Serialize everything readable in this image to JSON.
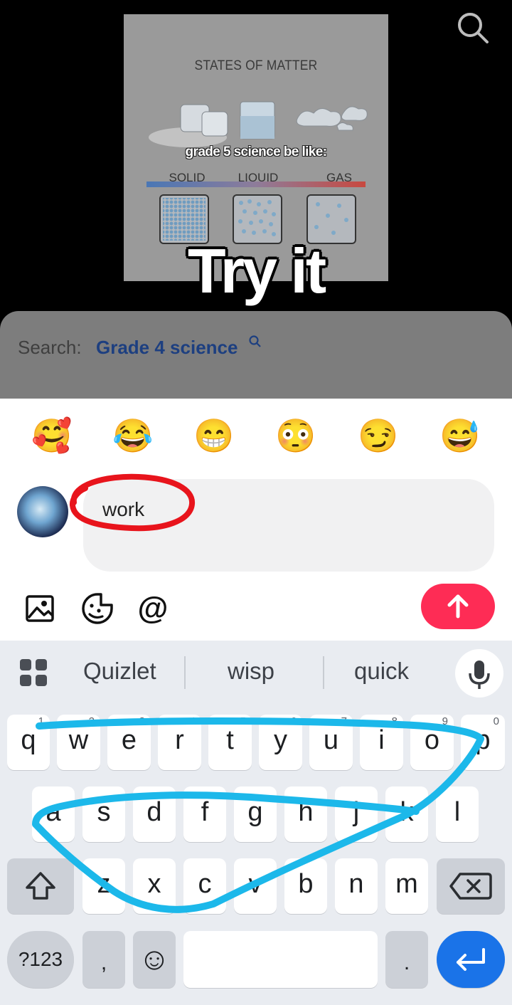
{
  "video": {
    "poster_title": "STATES OF MATTER",
    "meme_caption": "grade 5 science be like:",
    "states": [
      "SOLID",
      "LIQUID",
      "GAS"
    ],
    "overlay_text": "Try it"
  },
  "search_bar": {
    "prefix": "Search:",
    "query": "Grade 4 science",
    "icon": "search-icon"
  },
  "emoji_bar": [
    "🥰",
    "😂",
    "😁",
    "😳",
    "😏",
    "😅"
  ],
  "comment": {
    "input_value": "work",
    "annotation_color": "#e8141c",
    "tools": [
      "image-icon",
      "sticker-icon",
      "mention-icon"
    ],
    "mention_symbol": "@",
    "send_color": "#fe2c55"
  },
  "keyboard": {
    "suggestions": [
      "Quizlet",
      "wisp",
      "quick"
    ],
    "row1": [
      "q",
      "w",
      "e",
      "r",
      "t",
      "y",
      "u",
      "i",
      "o",
      "p"
    ],
    "row1_numbers": [
      "1",
      "2",
      "3",
      "4",
      "5",
      "6",
      "7",
      "8",
      "9",
      "0"
    ],
    "row2": [
      "a",
      "s",
      "d",
      "f",
      "g",
      "h",
      "j",
      "k",
      "l"
    ],
    "row3": [
      "z",
      "x",
      "c",
      "v",
      "b",
      "n",
      "m"
    ],
    "symbols_key": "?123",
    "comma_key": ",",
    "emoji_key": "☺",
    "period_key": ".",
    "scribble_color": "#1cb8ea",
    "enter_color": "#1a73e8"
  }
}
